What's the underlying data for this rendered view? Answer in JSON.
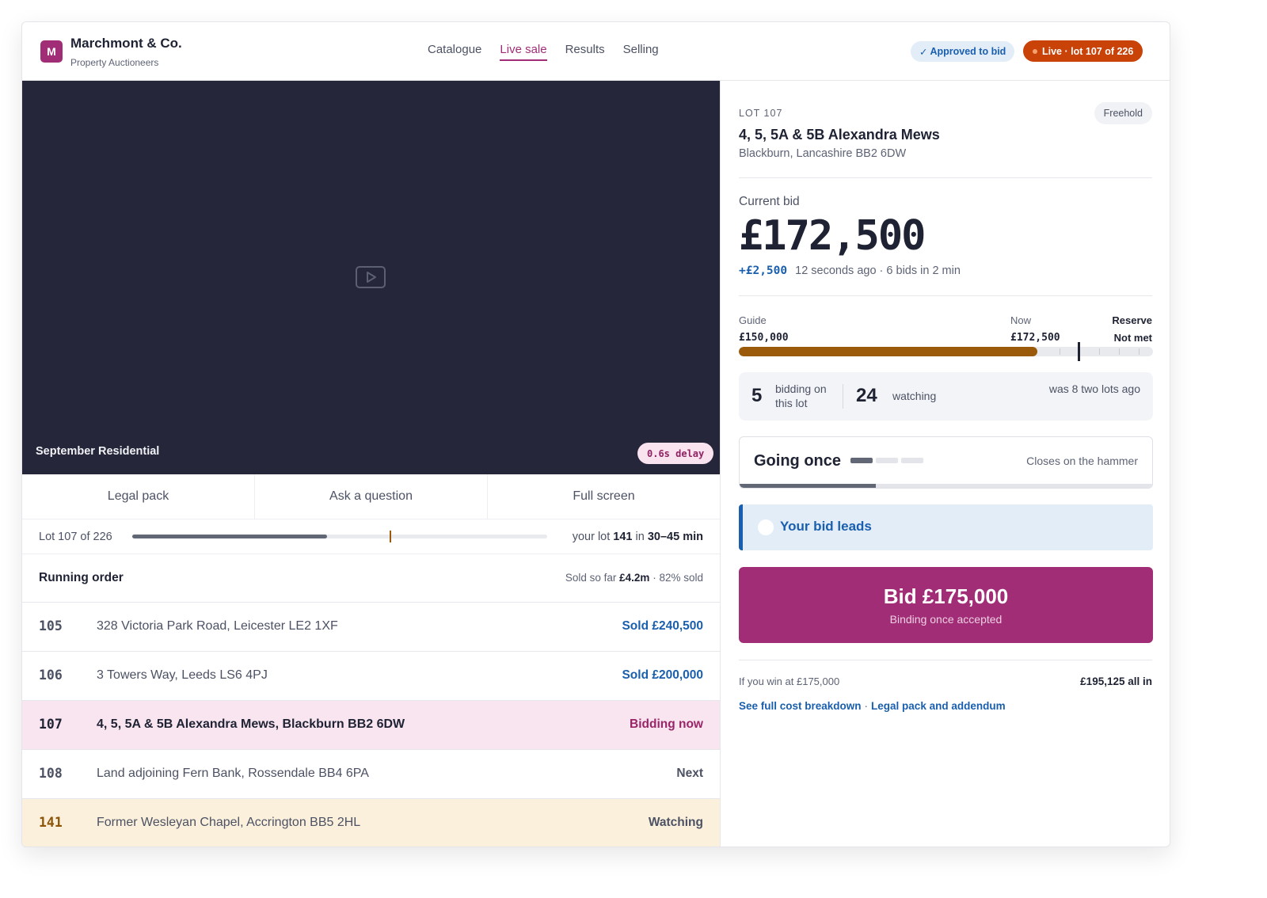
{
  "brand": {
    "logo_letter": "M",
    "name": "Marchmont & Co.",
    "subtitle": "Property Auctioneers"
  },
  "nav": {
    "items": [
      "Catalogue",
      "Live sale",
      "Results",
      "Selling"
    ],
    "active": "Live sale"
  },
  "status": {
    "approved": "Approved to bid",
    "live": "Live · lot 107 of 226"
  },
  "video": {
    "title": "September Residential",
    "delay": "0.6s delay"
  },
  "actions": {
    "legal_pack": "Legal pack",
    "ask_question": "Ask a question",
    "full_screen": "Full screen"
  },
  "sale_progress": {
    "label": "Lot 107 of 226",
    "fraction_complete": 0.47,
    "your_lot_marker_fraction": 0.62,
    "your_lot_prefix": "your lot",
    "your_lot": "141",
    "in_word": "in",
    "eta": "30–45 min"
  },
  "running_order": {
    "title": "Running order",
    "sold_so_far_label": "Sold so far",
    "sold_so_far_value": "£4.2m",
    "sold_pct": "· 82% sold",
    "rows": [
      {
        "lot": "105",
        "address": "328 Victoria Park Road, Leicester LE2 1XF",
        "status": "Sold £240,500",
        "state": "sold"
      },
      {
        "lot": "106",
        "address": "3 Towers Way, Leeds LS6 4PJ",
        "status": "Sold £200,000",
        "state": "sold"
      },
      {
        "lot": "107",
        "address": "4, 5, 5A & 5B Alexandra Mews, Blackburn BB2 6DW",
        "status": "Bidding now",
        "state": "current"
      },
      {
        "lot": "108",
        "address": "Land adjoining Fern Bank, Rossendale BB4 6PA",
        "status": "Next",
        "state": "upcoming"
      },
      {
        "lot": "141",
        "address": "Former Wesleyan Chapel, Accrington BB5 2HL",
        "status": "Watching",
        "state": "watch"
      }
    ]
  },
  "lot": {
    "label": "LOT 107",
    "tenure": "Freehold",
    "title": "4, 5, 5A & 5B Alexandra Mews",
    "location": "Blackburn, Lancashire BB2 6DW"
  },
  "bid": {
    "current_label": "Current bid",
    "current_value": "£172,500",
    "increment": "+£2,500",
    "meta": "12 seconds ago · 6 bids in 2 min"
  },
  "guide": {
    "guide_label": "Guide",
    "guide_value": "£150,000",
    "now_label": "Now",
    "now_value": "£172,500",
    "reserve_label": "Reserve",
    "reserve_value": "Not met",
    "fill_fraction": 0.72,
    "reserve_marker_fraction": 0.82
  },
  "bidders": {
    "bidding_count": "5",
    "bidding_label": "bidding on this lot",
    "watching_count": "24",
    "watching_label": "watching",
    "was_note": "was 8 two lots ago"
  },
  "going": {
    "label": "Going once",
    "segments_total": 3,
    "segments_on": 1,
    "note": "Closes on the hammer",
    "countdown_fraction": 0.33
  },
  "leads": {
    "text": "Your bid leads"
  },
  "bid_button": {
    "label": "Bid £175,000",
    "sub": "Binding once accepted"
  },
  "cost": {
    "if_win": "If you win at £175,000",
    "total": "£195,125 all in",
    "link1": "See full cost breakdown",
    "sep": "·",
    "link2": "Legal pack and addendum"
  },
  "colors": {
    "brand": "#a12d77",
    "live": "#c94208",
    "link": "#1a5fae",
    "guide_fill": "#9a5a09",
    "video_bg": "#25263a"
  }
}
